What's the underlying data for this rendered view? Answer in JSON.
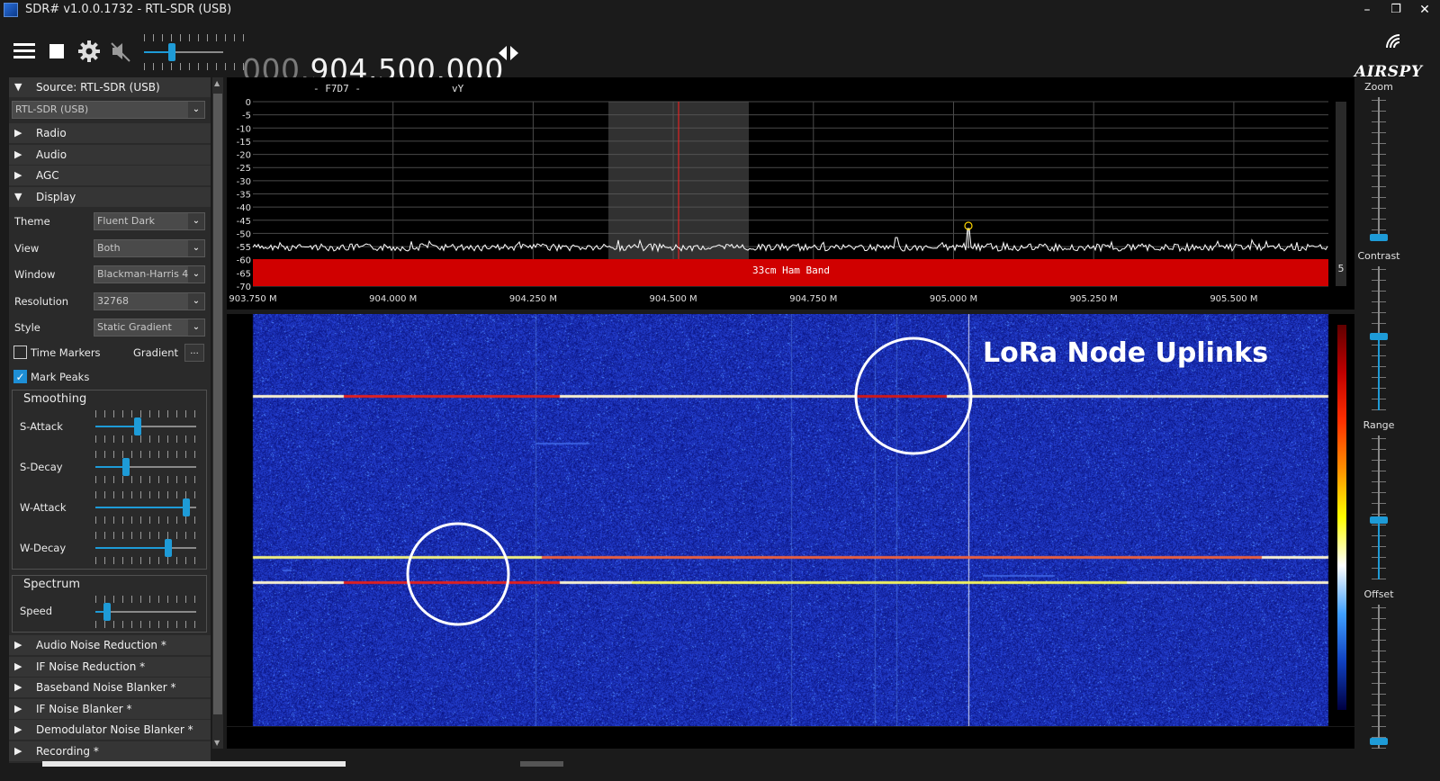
{
  "window": {
    "title": "SDR# v1.0.0.1732 - RTL-SDR (USB)",
    "minimize": "–",
    "maximize": "❐",
    "close": "✕"
  },
  "toolbar": {
    "menu_icon": "hamburger-menu-icon",
    "stop_icon": "stop-icon",
    "settings_icon": "gear-icon",
    "mute_icon": "speaker-muted-icon",
    "volume_level": 0.35,
    "frequency_dim": "000.",
    "frequency_main": "904.500.000",
    "tuning_arrows_icon": "left-right-arrows-icon",
    "brand": "AIRSPY"
  },
  "left_panel": {
    "source_header": "Source: RTL-SDR (USB)",
    "source_device": "RTL-SDR (USB)",
    "sections": [
      "Radio",
      "Audio",
      "AGC"
    ],
    "display_header": "Display",
    "display": {
      "theme_label": "Theme",
      "theme_value": "Fluent Dark",
      "view_label": "View",
      "view_value": "Both",
      "window_label": "Window",
      "window_value": "Blackman-Harris 4",
      "resolution_label": "Resolution",
      "resolution_value": "32768",
      "style_label": "Style",
      "style_value": "Static Gradient",
      "time_markers_label": "Time Markers",
      "time_markers_checked": false,
      "gradient_label": "Gradient",
      "gradient_button": "...",
      "mark_peaks_label": "Mark Peaks",
      "mark_peaks_checked": true
    },
    "smoothing": {
      "title": "Smoothing",
      "s_attack_label": "S-Attack",
      "s_attack": 0.42,
      "s_decay_label": "S-Decay",
      "s_decay": 0.3,
      "w_attack_label": "W-Attack",
      "w_attack": 0.9,
      "w_decay_label": "W-Decay",
      "w_decay": 0.72
    },
    "spectrum_group": {
      "title": "Spectrum",
      "speed_label": "Speed",
      "speed": 0.12
    },
    "plugins": [
      "Audio Noise Reduction *",
      "IF Noise Reduction *",
      "Baseband Noise Blanker *",
      "IF Noise Blanker *",
      "Demodulator Noise Blanker *",
      "Recording *"
    ]
  },
  "spectrum": {
    "top_labels": [
      "- F7D7 -",
      "vY"
    ],
    "db_ticks": [
      "0",
      "-5",
      "-10",
      "-15",
      "-20",
      "-25",
      "-30",
      "-35",
      "-40",
      "-45",
      "-50",
      "-55",
      "-60",
      "-65",
      "-70"
    ],
    "freq_ticks": [
      "903.750 M",
      "904.000 M",
      "904.250 M",
      "904.500 M",
      "904.750 M",
      "905.000 M",
      "905.250 M",
      "905.500 M"
    ],
    "band_label": "33cm Ham Band",
    "scroll_value": "5"
  },
  "waterfall": {
    "annotation": "LoRa Node Uplinks"
  },
  "right_controls": {
    "zoom_label": "Zoom",
    "contrast_label": "Contrast",
    "range_label": "Range",
    "offset_label": "Offset"
  },
  "colors": {
    "accent": "#1e9bd7",
    "band_red": "#d00000",
    "waterfall_bg": "#1a2aa0"
  }
}
